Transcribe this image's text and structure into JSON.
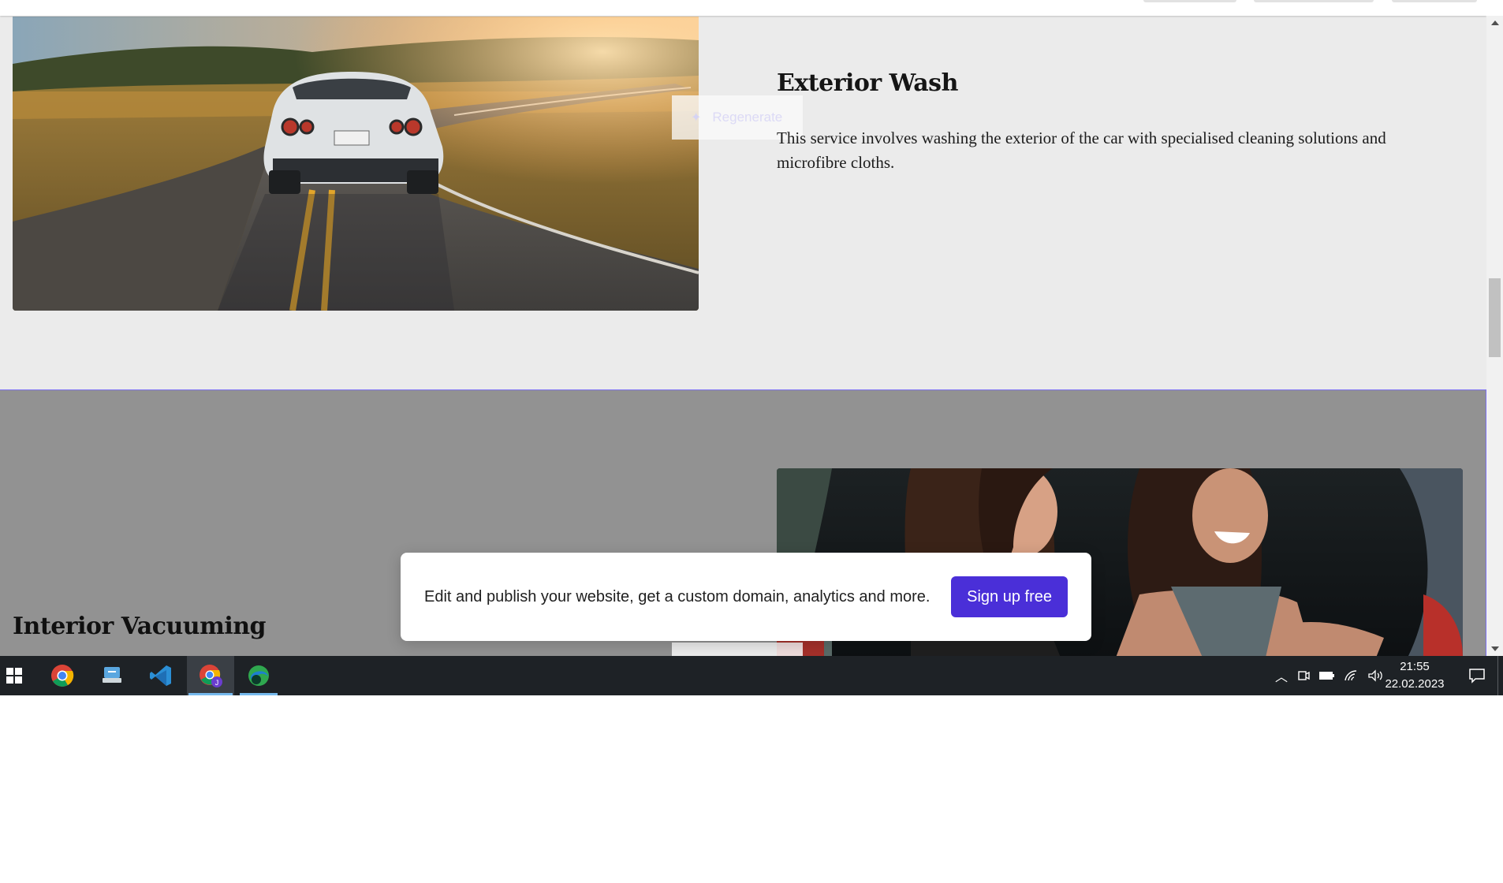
{
  "exterior": {
    "title": "Exterior Wash",
    "description": "This service involves washing the exterior of the car with specialised cleaning solutions and microfibre cloths.",
    "regenerate_label": "Regenerate"
  },
  "interior": {
    "title": "Interior Vacuuming"
  },
  "signup_banner": {
    "message": "Edit and publish your website, get a custom domain, analytics and more.",
    "cta_label": "Sign up free",
    "cta_color": "#4a2fd8"
  },
  "taskbar": {
    "apps": [
      {
        "name": "start-icon"
      },
      {
        "name": "chrome-icon"
      },
      {
        "name": "file-transfer-icon"
      },
      {
        "name": "vscode-icon"
      },
      {
        "name": "chrome-profile-icon",
        "active": true
      },
      {
        "name": "edge-dev-icon",
        "active": true
      }
    ],
    "clock_time": "21:55",
    "clock_date": "22.02.2023"
  }
}
